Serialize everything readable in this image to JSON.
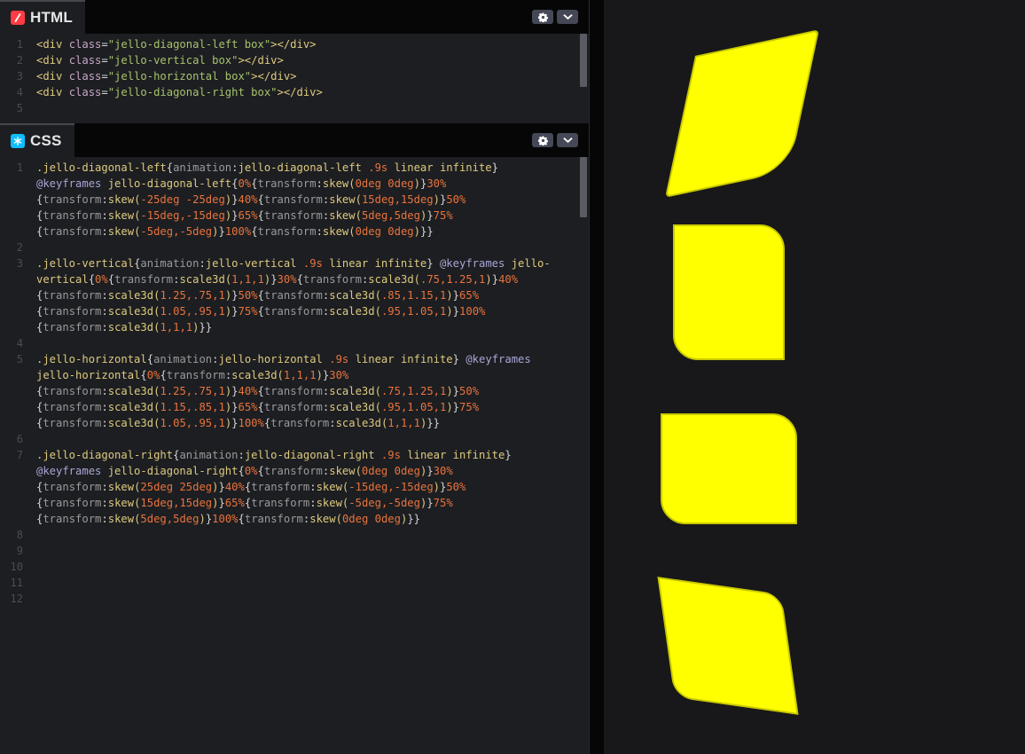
{
  "html_panel": {
    "tab_label": "HTML",
    "icon": "html-logo-icon",
    "line_numbers": [
      "1",
      "2",
      "3",
      "4",
      "5"
    ],
    "lines": [
      [
        [
          "t-tag",
          "<div "
        ],
        [
          "t-attr",
          "class"
        ],
        [
          "t-plain",
          "="
        ],
        [
          "t-str",
          "\"jello-diagonal-left box\""
        ],
        [
          "t-tag",
          "></div>"
        ]
      ],
      [
        [
          "t-tag",
          "<div "
        ],
        [
          "t-attr",
          "class"
        ],
        [
          "t-plain",
          "="
        ],
        [
          "t-str",
          "\"jello-vertical box\""
        ],
        [
          "t-tag",
          "></div>"
        ]
      ],
      [
        [
          "t-tag",
          "<div "
        ],
        [
          "t-attr",
          "class"
        ],
        [
          "t-plain",
          "="
        ],
        [
          "t-str",
          "\"jello-horizontal box\""
        ],
        [
          "t-tag",
          "></div>"
        ]
      ],
      [
        [
          "t-tag",
          "<div "
        ],
        [
          "t-attr",
          "class"
        ],
        [
          "t-plain",
          "="
        ],
        [
          "t-str",
          "\"jello-diagonal-right box\""
        ],
        [
          "t-tag",
          "></div>"
        ]
      ],
      []
    ]
  },
  "css_panel": {
    "tab_label": "CSS",
    "icon": "css-logo-icon",
    "line_numbers": [
      "1",
      "",
      "",
      "",
      "",
      "2",
      "3",
      "",
      "",
      "",
      "",
      "4",
      "5",
      "",
      "",
      "",
      "",
      "6",
      "7",
      "",
      "",
      "",
      "",
      "8",
      "9",
      "10",
      "11",
      "12"
    ],
    "lines": [
      [
        [
          "t-sel",
          ".jello-diagonal-left"
        ],
        [
          "t-plain",
          "{"
        ],
        [
          "t-prop",
          "animation"
        ],
        [
          "t-plain",
          ":"
        ],
        [
          "t-val",
          "jello-diagonal-left "
        ],
        [
          "t-num",
          ".9s"
        ],
        [
          "t-val",
          " linear infinite"
        ],
        [
          "t-plain",
          "}"
        ]
      ],
      [
        [
          "t-at",
          "@keyframes"
        ],
        [
          "t-val",
          " jello-diagonal-left"
        ],
        [
          "t-plain",
          "{"
        ],
        [
          "t-num",
          "0%"
        ],
        [
          "t-plain",
          "{"
        ],
        [
          "t-prop",
          "transform"
        ],
        [
          "t-plain",
          ":"
        ],
        [
          "t-val",
          "skew("
        ],
        [
          "t-num",
          "0deg 0deg"
        ],
        [
          "t-val",
          ")"
        ],
        [
          "t-plain",
          "}"
        ],
        [
          "t-num",
          "30%"
        ]
      ],
      [
        [
          "t-plain",
          "{"
        ],
        [
          "t-prop",
          "transform"
        ],
        [
          "t-plain",
          ":"
        ],
        [
          "t-val",
          "skew("
        ],
        [
          "t-num",
          "-25deg -25deg"
        ],
        [
          "t-val",
          ")"
        ],
        [
          "t-plain",
          "}"
        ],
        [
          "t-num",
          "40%"
        ],
        [
          "t-plain",
          "{"
        ],
        [
          "t-prop",
          "transform"
        ],
        [
          "t-plain",
          ":"
        ],
        [
          "t-val",
          "skew("
        ],
        [
          "t-num",
          "15deg,15deg"
        ],
        [
          "t-val",
          ")"
        ],
        [
          "t-plain",
          "}"
        ],
        [
          "t-num",
          "50%"
        ]
      ],
      [
        [
          "t-plain",
          "{"
        ],
        [
          "t-prop",
          "transform"
        ],
        [
          "t-plain",
          ":"
        ],
        [
          "t-val",
          "skew("
        ],
        [
          "t-num",
          "-15deg,-15deg"
        ],
        [
          "t-val",
          ")"
        ],
        [
          "t-plain",
          "}"
        ],
        [
          "t-num",
          "65%"
        ],
        [
          "t-plain",
          "{"
        ],
        [
          "t-prop",
          "transform"
        ],
        [
          "t-plain",
          ":"
        ],
        [
          "t-val",
          "skew("
        ],
        [
          "t-num",
          "5deg,5deg"
        ],
        [
          "t-val",
          ")"
        ],
        [
          "t-plain",
          "}"
        ],
        [
          "t-num",
          "75%"
        ]
      ],
      [
        [
          "t-plain",
          "{"
        ],
        [
          "t-prop",
          "transform"
        ],
        [
          "t-plain",
          ":"
        ],
        [
          "t-val",
          "skew("
        ],
        [
          "t-num",
          "-5deg,-5deg"
        ],
        [
          "t-val",
          ")"
        ],
        [
          "t-plain",
          "}"
        ],
        [
          "t-num",
          "100%"
        ],
        [
          "t-plain",
          "{"
        ],
        [
          "t-prop",
          "transform"
        ],
        [
          "t-plain",
          ":"
        ],
        [
          "t-val",
          "skew("
        ],
        [
          "t-num",
          "0deg 0deg"
        ],
        [
          "t-val",
          ")"
        ],
        [
          "t-plain",
          "}}"
        ]
      ],
      [],
      [
        [
          "t-sel",
          ".jello-vertical"
        ],
        [
          "t-plain",
          "{"
        ],
        [
          "t-prop",
          "animation"
        ],
        [
          "t-plain",
          ":"
        ],
        [
          "t-val",
          "jello-vertical "
        ],
        [
          "t-num",
          ".9s"
        ],
        [
          "t-val",
          " linear infinite"
        ],
        [
          "t-plain",
          "} "
        ],
        [
          "t-at",
          "@keyframes"
        ],
        [
          "t-val",
          " jello-"
        ]
      ],
      [
        [
          "t-val",
          "vertical"
        ],
        [
          "t-plain",
          "{"
        ],
        [
          "t-num",
          "0%"
        ],
        [
          "t-plain",
          "{"
        ],
        [
          "t-prop",
          "transform"
        ],
        [
          "t-plain",
          ":"
        ],
        [
          "t-val",
          "scale3d("
        ],
        [
          "t-num",
          "1,1,1"
        ],
        [
          "t-val",
          ")"
        ],
        [
          "t-plain",
          "}"
        ],
        [
          "t-num",
          "30%"
        ],
        [
          "t-plain",
          "{"
        ],
        [
          "t-prop",
          "transform"
        ],
        [
          "t-plain",
          ":"
        ],
        [
          "t-val",
          "scale3d("
        ],
        [
          "t-num",
          ".75,1.25,1"
        ],
        [
          "t-val",
          ")"
        ],
        [
          "t-plain",
          "}"
        ],
        [
          "t-num",
          "40%"
        ]
      ],
      [
        [
          "t-plain",
          "{"
        ],
        [
          "t-prop",
          "transform"
        ],
        [
          "t-plain",
          ":"
        ],
        [
          "t-val",
          "scale3d("
        ],
        [
          "t-num",
          "1.25,.75,1"
        ],
        [
          "t-val",
          ")"
        ],
        [
          "t-plain",
          "}"
        ],
        [
          "t-num",
          "50%"
        ],
        [
          "t-plain",
          "{"
        ],
        [
          "t-prop",
          "transform"
        ],
        [
          "t-plain",
          ":"
        ],
        [
          "t-val",
          "scale3d("
        ],
        [
          "t-num",
          ".85,1.15,1"
        ],
        [
          "t-val",
          ")"
        ],
        [
          "t-plain",
          "}"
        ],
        [
          "t-num",
          "65%"
        ]
      ],
      [
        [
          "t-plain",
          "{"
        ],
        [
          "t-prop",
          "transform"
        ],
        [
          "t-plain",
          ":"
        ],
        [
          "t-val",
          "scale3d("
        ],
        [
          "t-num",
          "1.05,.95,1"
        ],
        [
          "t-val",
          ")"
        ],
        [
          "t-plain",
          "}"
        ],
        [
          "t-num",
          "75%"
        ],
        [
          "t-plain",
          "{"
        ],
        [
          "t-prop",
          "transform"
        ],
        [
          "t-plain",
          ":"
        ],
        [
          "t-val",
          "scale3d("
        ],
        [
          "t-num",
          ".95,1.05,1"
        ],
        [
          "t-val",
          ")"
        ],
        [
          "t-plain",
          "}"
        ],
        [
          "t-num",
          "100%"
        ]
      ],
      [
        [
          "t-plain",
          "{"
        ],
        [
          "t-prop",
          "transform"
        ],
        [
          "t-plain",
          ":"
        ],
        [
          "t-val",
          "scale3d("
        ],
        [
          "t-num",
          "1,1,1"
        ],
        [
          "t-val",
          ")"
        ],
        [
          "t-plain",
          "}}"
        ]
      ],
      [],
      [
        [
          "t-sel",
          ".jello-horizontal"
        ],
        [
          "t-plain",
          "{"
        ],
        [
          "t-prop",
          "animation"
        ],
        [
          "t-plain",
          ":"
        ],
        [
          "t-val",
          "jello-horizontal "
        ],
        [
          "t-num",
          ".9s"
        ],
        [
          "t-val",
          " linear infinite"
        ],
        [
          "t-plain",
          "} "
        ],
        [
          "t-at",
          "@keyframes"
        ]
      ],
      [
        [
          "t-val",
          "jello-horizontal"
        ],
        [
          "t-plain",
          "{"
        ],
        [
          "t-num",
          "0%"
        ],
        [
          "t-plain",
          "{"
        ],
        [
          "t-prop",
          "transform"
        ],
        [
          "t-plain",
          ":"
        ],
        [
          "t-val",
          "scale3d("
        ],
        [
          "t-num",
          "1,1,1"
        ],
        [
          "t-val",
          ")"
        ],
        [
          "t-plain",
          "}"
        ],
        [
          "t-num",
          "30%"
        ]
      ],
      [
        [
          "t-plain",
          "{"
        ],
        [
          "t-prop",
          "transform"
        ],
        [
          "t-plain",
          ":"
        ],
        [
          "t-val",
          "scale3d("
        ],
        [
          "t-num",
          "1.25,.75,1"
        ],
        [
          "t-val",
          ")"
        ],
        [
          "t-plain",
          "}"
        ],
        [
          "t-num",
          "40%"
        ],
        [
          "t-plain",
          "{"
        ],
        [
          "t-prop",
          "transform"
        ],
        [
          "t-plain",
          ":"
        ],
        [
          "t-val",
          "scale3d("
        ],
        [
          "t-num",
          ".75,1.25,1"
        ],
        [
          "t-val",
          ")"
        ],
        [
          "t-plain",
          "}"
        ],
        [
          "t-num",
          "50%"
        ]
      ],
      [
        [
          "t-plain",
          "{"
        ],
        [
          "t-prop",
          "transform"
        ],
        [
          "t-plain",
          ":"
        ],
        [
          "t-val",
          "scale3d("
        ],
        [
          "t-num",
          "1.15,.85,1"
        ],
        [
          "t-val",
          ")"
        ],
        [
          "t-plain",
          "}"
        ],
        [
          "t-num",
          "65%"
        ],
        [
          "t-plain",
          "{"
        ],
        [
          "t-prop",
          "transform"
        ],
        [
          "t-plain",
          ":"
        ],
        [
          "t-val",
          "scale3d("
        ],
        [
          "t-num",
          ".95,1.05,1"
        ],
        [
          "t-val",
          ")"
        ],
        [
          "t-plain",
          "}"
        ],
        [
          "t-num",
          "75%"
        ]
      ],
      [
        [
          "t-plain",
          "{"
        ],
        [
          "t-prop",
          "transform"
        ],
        [
          "t-plain",
          ":"
        ],
        [
          "t-val",
          "scale3d("
        ],
        [
          "t-num",
          "1.05,.95,1"
        ],
        [
          "t-val",
          ")"
        ],
        [
          "t-plain",
          "}"
        ],
        [
          "t-num",
          "100%"
        ],
        [
          "t-plain",
          "{"
        ],
        [
          "t-prop",
          "transform"
        ],
        [
          "t-plain",
          ":"
        ],
        [
          "t-val",
          "scale3d("
        ],
        [
          "t-num",
          "1,1,1"
        ],
        [
          "t-val",
          ")"
        ],
        [
          "t-plain",
          "}}"
        ]
      ],
      [],
      [
        [
          "t-sel",
          ".jello-diagonal-right"
        ],
        [
          "t-plain",
          "{"
        ],
        [
          "t-prop",
          "animation"
        ],
        [
          "t-plain",
          ":"
        ],
        [
          "t-val",
          "jello-diagonal-right "
        ],
        [
          "t-num",
          ".9s"
        ],
        [
          "t-val",
          " linear infinite"
        ],
        [
          "t-plain",
          "}"
        ]
      ],
      [
        [
          "t-at",
          "@keyframes"
        ],
        [
          "t-val",
          " jello-diagonal-right"
        ],
        [
          "t-plain",
          "{"
        ],
        [
          "t-num",
          "0%"
        ],
        [
          "t-plain",
          "{"
        ],
        [
          "t-prop",
          "transform"
        ],
        [
          "t-plain",
          ":"
        ],
        [
          "t-val",
          "skew("
        ],
        [
          "t-num",
          "0deg 0deg"
        ],
        [
          "t-val",
          ")"
        ],
        [
          "t-plain",
          "}"
        ],
        [
          "t-num",
          "30%"
        ]
      ],
      [
        [
          "t-plain",
          "{"
        ],
        [
          "t-prop",
          "transform"
        ],
        [
          "t-plain",
          ":"
        ],
        [
          "t-val",
          "skew("
        ],
        [
          "t-num",
          "25deg 25deg"
        ],
        [
          "t-val",
          ")"
        ],
        [
          "t-plain",
          "}"
        ],
        [
          "t-num",
          "40%"
        ],
        [
          "t-plain",
          "{"
        ],
        [
          "t-prop",
          "transform"
        ],
        [
          "t-plain",
          ":"
        ],
        [
          "t-val",
          "skew("
        ],
        [
          "t-num",
          "-15deg,-15deg"
        ],
        [
          "t-val",
          ")"
        ],
        [
          "t-plain",
          "}"
        ],
        [
          "t-num",
          "50%"
        ]
      ],
      [
        [
          "t-plain",
          "{"
        ],
        [
          "t-prop",
          "transform"
        ],
        [
          "t-plain",
          ":"
        ],
        [
          "t-val",
          "skew("
        ],
        [
          "t-num",
          "15deg,15deg"
        ],
        [
          "t-val",
          ")"
        ],
        [
          "t-plain",
          "}"
        ],
        [
          "t-num",
          "65%"
        ],
        [
          "t-plain",
          "{"
        ],
        [
          "t-prop",
          "transform"
        ],
        [
          "t-plain",
          ":"
        ],
        [
          "t-val",
          "skew("
        ],
        [
          "t-num",
          "-5deg,-5deg"
        ],
        [
          "t-val",
          ")"
        ],
        [
          "t-plain",
          "}"
        ],
        [
          "t-num",
          "75%"
        ]
      ],
      [
        [
          "t-plain",
          "{"
        ],
        [
          "t-prop",
          "transform"
        ],
        [
          "t-plain",
          ":"
        ],
        [
          "t-val",
          "skew("
        ],
        [
          "t-num",
          "5deg,5deg"
        ],
        [
          "t-val",
          ")"
        ],
        [
          "t-plain",
          "}"
        ],
        [
          "t-num",
          "100%"
        ],
        [
          "t-plain",
          "{"
        ],
        [
          "t-prop",
          "transform"
        ],
        [
          "t-plain",
          ":"
        ],
        [
          "t-val",
          "skew("
        ],
        [
          "t-num",
          "0deg 0deg"
        ],
        [
          "t-val",
          ")"
        ],
        [
          "t-plain",
          "}}"
        ]
      ],
      [],
      [],
      [],
      [],
      []
    ]
  },
  "buttons": {
    "settings_icon": "gear-icon",
    "collapse_icon": "chevron-down-icon"
  },
  "preview": {
    "box_color": "#ffff00",
    "boxes": [
      {
        "name": "jello-diagonal-left-box",
        "class": "jello-diagonal-left box"
      },
      {
        "name": "jello-vertical-box",
        "class": "jello-vertical box"
      },
      {
        "name": "jello-horizontal-box",
        "class": "jello-horizontal box"
      },
      {
        "name": "jello-diagonal-right-box",
        "class": "jello-diagonal-right box"
      }
    ]
  }
}
